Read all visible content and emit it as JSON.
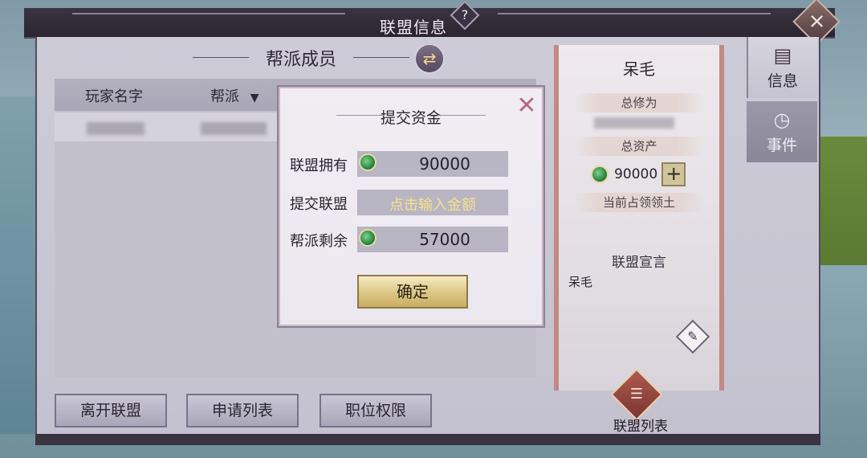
{
  "window": {
    "title": "联盟信息",
    "help_icon": "?",
    "close_icon": "×"
  },
  "members_panel": {
    "title": "帮派成员",
    "swap_icon": "⇄",
    "columns": [
      "玩家名字",
      "帮派"
    ],
    "gang_filter_icon": "▼"
  },
  "bottom_buttons": {
    "leave": "离开联盟",
    "applications": "申请列表",
    "permissions": "职位权限"
  },
  "alliance_card": {
    "name": "呆毛",
    "total_cultivation_label": "总修为",
    "total_assets_label": "总资产",
    "total_assets_value": "90000",
    "plus_icon": "+",
    "territory_label": "当前占领领土",
    "declaration_title": "联盟宣言",
    "declaration_text": "呆毛",
    "edit_icon": "✎",
    "list_icon": "☰",
    "list_label": "联盟列表"
  },
  "tabs": [
    {
      "label": "信息",
      "icon": "▤"
    },
    {
      "label": "事件",
      "icon": "◷"
    }
  ],
  "dialog": {
    "title": "提交资金",
    "close_icon": "✕",
    "owned_label": "联盟拥有",
    "owned_value": "90000",
    "submit_label": "提交联盟",
    "submit_placeholder": "点击输入金额",
    "remain_label": "帮派剩余",
    "remain_value": "57000",
    "confirm": "确定"
  }
}
